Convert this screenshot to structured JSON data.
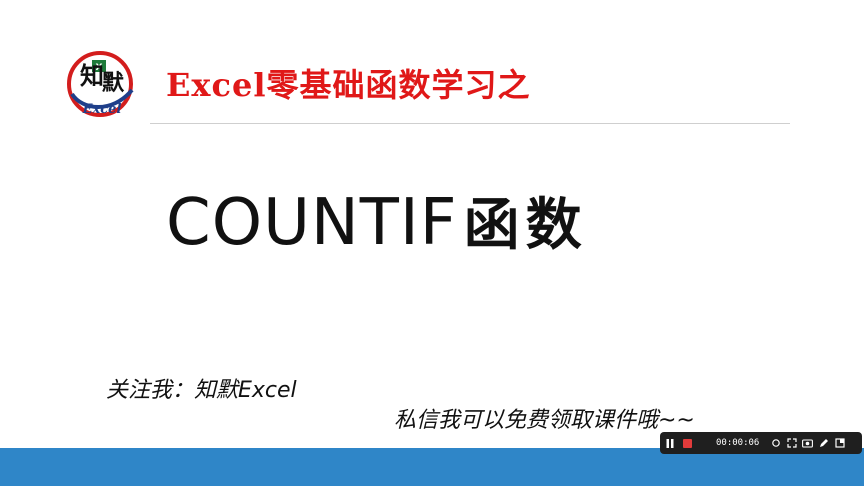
{
  "logo": {
    "glyph_1": "知",
    "glyph_2": "默",
    "wordmark": "Excel",
    "colors": {
      "ring": "#d31d1d",
      "swash": "#1f3f8a",
      "excel_badge": "#1e7b3a"
    }
  },
  "header": {
    "title": "Excel零基础函数学习之",
    "color": "#e01818"
  },
  "main": {
    "title_en": "COUNTIF",
    "title_zh": "函数"
  },
  "footer": {
    "follow_text": "关注我：知默Excel",
    "promo_text": "私信我可以免费领取课件哦~~",
    "bar_color": "#2f86c8"
  },
  "recorder": {
    "time": "00:00:06",
    "icons": [
      "pause-icon",
      "stop-icon",
      "camera-focus-icon",
      "fullscreen-icon",
      "screenshot-icon",
      "pen-icon",
      "window-icon"
    ]
  }
}
